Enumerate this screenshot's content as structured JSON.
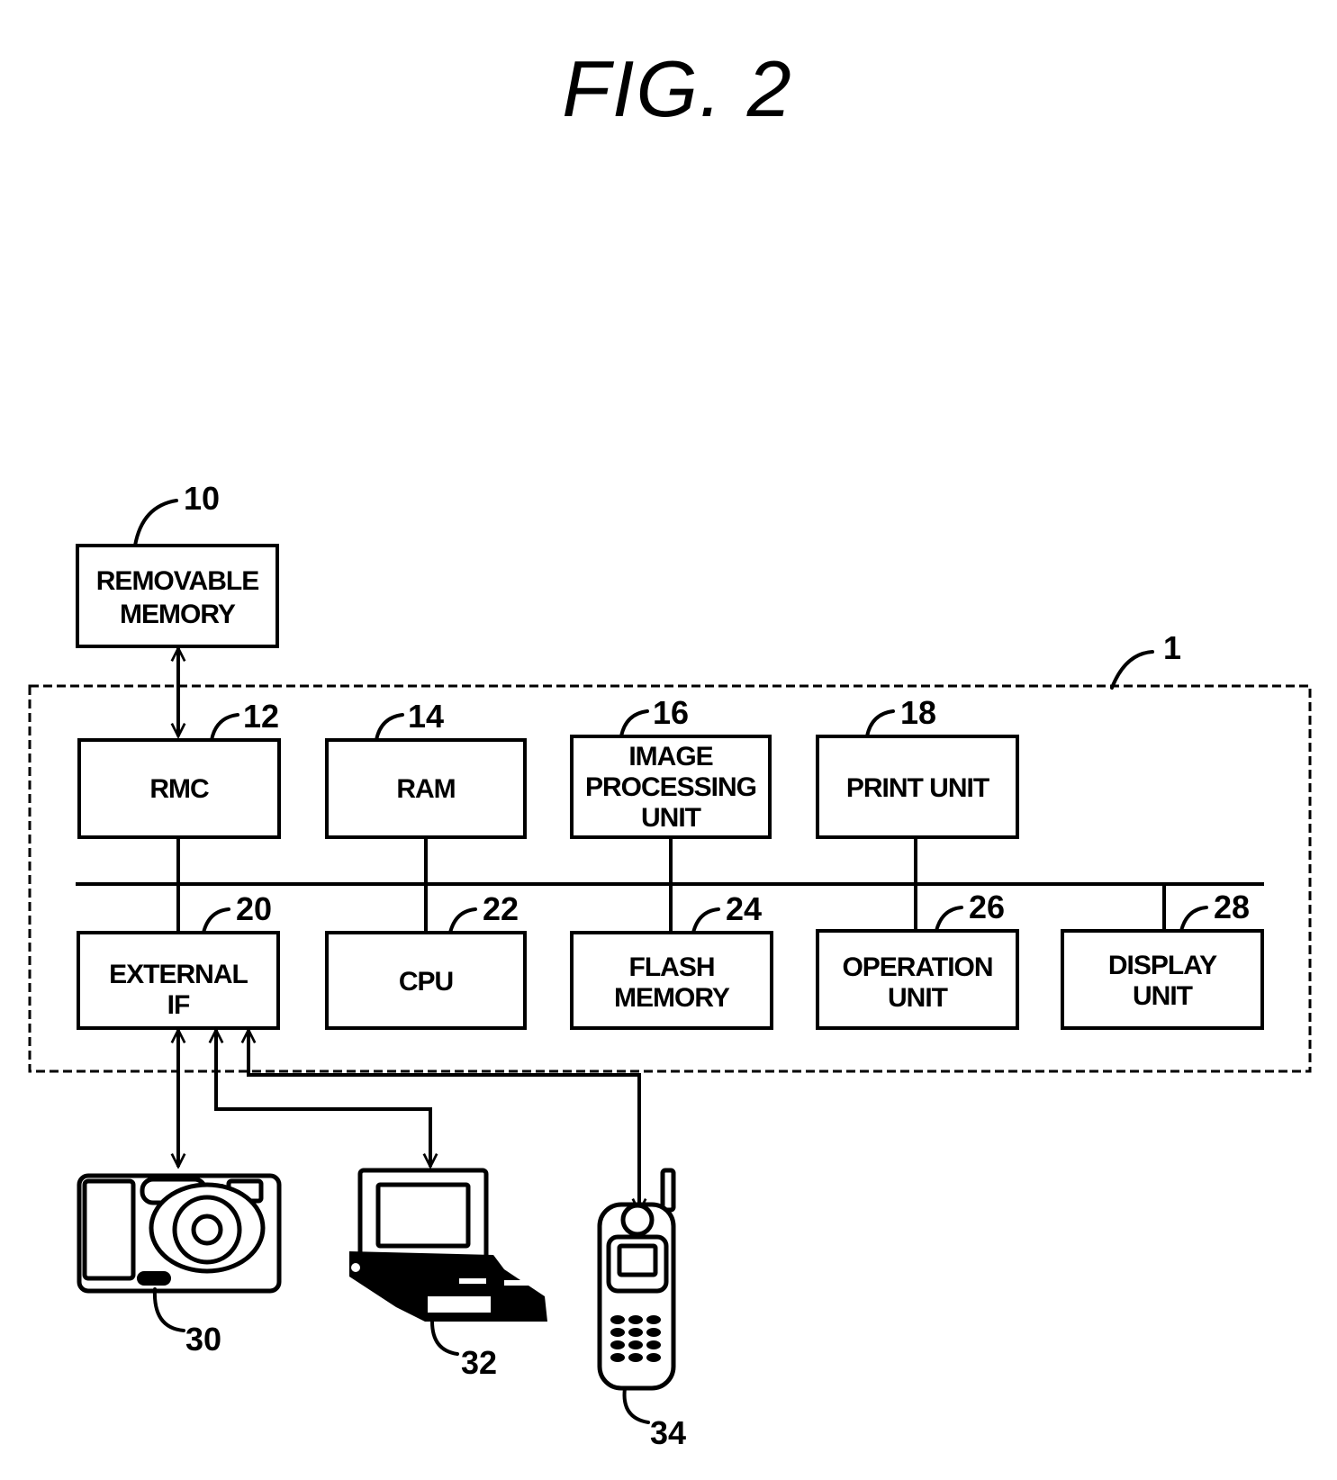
{
  "figure": {
    "title": "FIG. 2"
  },
  "system": {
    "ref": "1",
    "blocks": [
      {
        "id": "removable-memory",
        "ref": "10",
        "lines": [
          "REMOVABLE",
          "MEMORY"
        ]
      },
      {
        "id": "rmc",
        "ref": "12",
        "lines": [
          "RMC"
        ]
      },
      {
        "id": "ram",
        "ref": "14",
        "lines": [
          "RAM"
        ]
      },
      {
        "id": "image-processing-unit",
        "ref": "16",
        "lines": [
          "IMAGE",
          "PROCESSING",
          "UNIT"
        ]
      },
      {
        "id": "print-unit",
        "ref": "18",
        "lines": [
          "PRINT UNIT"
        ]
      },
      {
        "id": "external-if",
        "ref": "20",
        "lines": [
          "EXTERNAL",
          "IF"
        ]
      },
      {
        "id": "cpu",
        "ref": "22",
        "lines": [
          "CPU"
        ]
      },
      {
        "id": "flash-memory",
        "ref": "24",
        "lines": [
          "FLASH",
          "MEMORY"
        ]
      },
      {
        "id": "operation-unit",
        "ref": "26",
        "lines": [
          "OPERATION",
          "UNIT"
        ]
      },
      {
        "id": "display-unit",
        "ref": "28",
        "lines": [
          "DISPLAY",
          "UNIT"
        ]
      }
    ]
  },
  "devices": [
    {
      "id": "digital-camera",
      "ref": "30",
      "icon": "camera-icon"
    },
    {
      "id": "laptop-computer",
      "ref": "32",
      "icon": "laptop-icon"
    },
    {
      "id": "mobile-phone",
      "ref": "34",
      "icon": "mobile-phone-icon"
    }
  ]
}
